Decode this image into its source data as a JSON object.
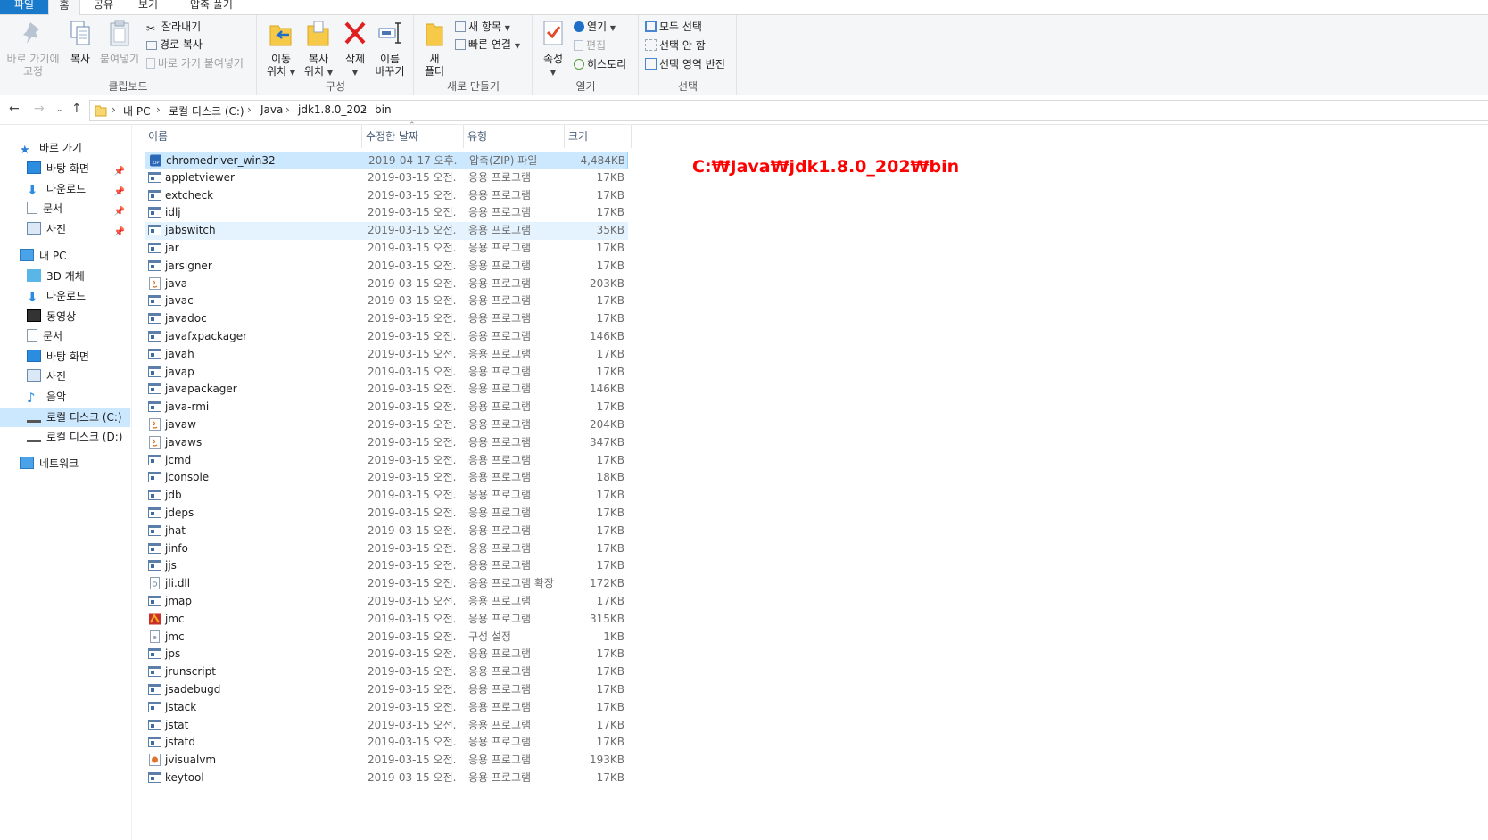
{
  "ribbon_tabs": [
    "파일",
    "홈",
    "공유",
    "보기",
    "압축 풀기"
  ],
  "ribbon": {
    "clipboard": {
      "pin_quick": "바로 가기에\n고정",
      "pin_quick_l1": "바로 가기에",
      "pin_quick_l2": "고정",
      "copy": "복사",
      "paste": "붙여넣기",
      "cut": "잘라내기",
      "copy_path": "경로 복사",
      "paste_shortcut": "바로 가기 붙여넣기",
      "label": "클립보드"
    },
    "organize": {
      "move_l1": "이동",
      "move_l2": "위치",
      "copyto_l1": "복사",
      "copyto_l2": "위치",
      "delete": "삭제",
      "rename_l1": "이름",
      "rename_l2": "바꾸기",
      "label": "구성"
    },
    "new": {
      "new_folder_l1": "새",
      "new_folder_l2": "폴더",
      "new_item": "새 항목",
      "easy_access": "빠른 연결",
      "label": "새로 만들기"
    },
    "open": {
      "properties": "속성",
      "open": "열기",
      "edit": "편집",
      "history": "히스토리",
      "label": "열기"
    },
    "select": {
      "select_all": "모두 선택",
      "select_none": "선택 안 함",
      "invert": "선택 영역 반전",
      "label": "선택"
    }
  },
  "breadcrumb": [
    "내 PC",
    "로컬 디스크 (C:)",
    "Java",
    "jdk1.8.0_202",
    "bin"
  ],
  "nav": {
    "quick_access": "바로 가기",
    "quick_items": [
      "바탕 화면",
      "다운로드",
      "문서",
      "사진"
    ],
    "this_pc": "내 PC",
    "pc_items": [
      "3D 개체",
      "다운로드",
      "동영상",
      "문서",
      "바탕 화면",
      "사진",
      "음악",
      "로컬 디스크 (C:)",
      "로컬 디스크 (D:)"
    ],
    "network": "네트워크"
  },
  "columns": [
    "이름",
    "수정한 날짜",
    "유형",
    "크기"
  ],
  "files": [
    {
      "name": "chromedriver_win32",
      "date": "2019-04-17 오후...",
      "type": "압축(ZIP) 파일",
      "size": "4,484KB",
      "icon": "zip"
    },
    {
      "name": "appletviewer",
      "date": "2019-03-15 오전...",
      "type": "응용 프로그램",
      "size": "17KB",
      "icon": "exe"
    },
    {
      "name": "extcheck",
      "date": "2019-03-15 오전...",
      "type": "응용 프로그램",
      "size": "17KB",
      "icon": "exe"
    },
    {
      "name": "idlj",
      "date": "2019-03-15 오전...",
      "type": "응용 프로그램",
      "size": "17KB",
      "icon": "exe"
    },
    {
      "name": "jabswitch",
      "date": "2019-03-15 오전...",
      "type": "응용 프로그램",
      "size": "35KB",
      "icon": "exe"
    },
    {
      "name": "jar",
      "date": "2019-03-15 오전...",
      "type": "응용 프로그램",
      "size": "17KB",
      "icon": "exe"
    },
    {
      "name": "jarsigner",
      "date": "2019-03-15 오전...",
      "type": "응용 프로그램",
      "size": "17KB",
      "icon": "exe"
    },
    {
      "name": "java",
      "date": "2019-03-15 오전...",
      "type": "응용 프로그램",
      "size": "203KB",
      "icon": "java"
    },
    {
      "name": "javac",
      "date": "2019-03-15 오전...",
      "type": "응용 프로그램",
      "size": "17KB",
      "icon": "exe"
    },
    {
      "name": "javadoc",
      "date": "2019-03-15 오전...",
      "type": "응용 프로그램",
      "size": "17KB",
      "icon": "exe"
    },
    {
      "name": "javafxpackager",
      "date": "2019-03-15 오전...",
      "type": "응용 프로그램",
      "size": "146KB",
      "icon": "exe"
    },
    {
      "name": "javah",
      "date": "2019-03-15 오전...",
      "type": "응용 프로그램",
      "size": "17KB",
      "icon": "exe"
    },
    {
      "name": "javap",
      "date": "2019-03-15 오전...",
      "type": "응용 프로그램",
      "size": "17KB",
      "icon": "exe"
    },
    {
      "name": "javapackager",
      "date": "2019-03-15 오전...",
      "type": "응용 프로그램",
      "size": "146KB",
      "icon": "exe"
    },
    {
      "name": "java-rmi",
      "date": "2019-03-15 오전...",
      "type": "응용 프로그램",
      "size": "17KB",
      "icon": "exe"
    },
    {
      "name": "javaw",
      "date": "2019-03-15 오전...",
      "type": "응용 프로그램",
      "size": "204KB",
      "icon": "java"
    },
    {
      "name": "javaws",
      "date": "2019-03-15 오전...",
      "type": "응용 프로그램",
      "size": "347KB",
      "icon": "java"
    },
    {
      "name": "jcmd",
      "date": "2019-03-15 오전...",
      "type": "응용 프로그램",
      "size": "17KB",
      "icon": "exe"
    },
    {
      "name": "jconsole",
      "date": "2019-03-15 오전...",
      "type": "응용 프로그램",
      "size": "18KB",
      "icon": "exe"
    },
    {
      "name": "jdb",
      "date": "2019-03-15 오전...",
      "type": "응용 프로그램",
      "size": "17KB",
      "icon": "exe"
    },
    {
      "name": "jdeps",
      "date": "2019-03-15 오전...",
      "type": "응용 프로그램",
      "size": "17KB",
      "icon": "exe"
    },
    {
      "name": "jhat",
      "date": "2019-03-15 오전...",
      "type": "응용 프로그램",
      "size": "17KB",
      "icon": "exe"
    },
    {
      "name": "jinfo",
      "date": "2019-03-15 오전...",
      "type": "응용 프로그램",
      "size": "17KB",
      "icon": "exe"
    },
    {
      "name": "jjs",
      "date": "2019-03-15 오전...",
      "type": "응용 프로그램",
      "size": "17KB",
      "icon": "exe"
    },
    {
      "name": "jli.dll",
      "date": "2019-03-15 오전...",
      "type": "응용 프로그램 확장",
      "size": "172KB",
      "icon": "dll"
    },
    {
      "name": "jmap",
      "date": "2019-03-15 오전...",
      "type": "응용 프로그램",
      "size": "17KB",
      "icon": "exe"
    },
    {
      "name": "jmc",
      "date": "2019-03-15 오전...",
      "type": "응용 프로그램",
      "size": "315KB",
      "icon": "jmc"
    },
    {
      "name": "jmc",
      "date": "2019-03-15 오전...",
      "type": "구성 설정",
      "size": "1KB",
      "icon": "ini"
    },
    {
      "name": "jps",
      "date": "2019-03-15 오전...",
      "type": "응용 프로그램",
      "size": "17KB",
      "icon": "exe"
    },
    {
      "name": "jrunscript",
      "date": "2019-03-15 오전...",
      "type": "응용 프로그램",
      "size": "17KB",
      "icon": "exe"
    },
    {
      "name": "jsadebugd",
      "date": "2019-03-15 오전...",
      "type": "응용 프로그램",
      "size": "17KB",
      "icon": "exe"
    },
    {
      "name": "jstack",
      "date": "2019-03-15 오전...",
      "type": "응용 프로그램",
      "size": "17KB",
      "icon": "exe"
    },
    {
      "name": "jstat",
      "date": "2019-03-15 오전...",
      "type": "응용 프로그램",
      "size": "17KB",
      "icon": "exe"
    },
    {
      "name": "jstatd",
      "date": "2019-03-15 오전...",
      "type": "응용 프로그램",
      "size": "17KB",
      "icon": "exe"
    },
    {
      "name": "jvisualvm",
      "date": "2019-03-15 오전...",
      "type": "응용 프로그램",
      "size": "193KB",
      "icon": "jvm"
    },
    {
      "name": "keytool",
      "date": "2019-03-15 오전...",
      "type": "응용 프로그램",
      "size": "17KB",
      "icon": "exe"
    }
  ],
  "path_annotation": "C:₩Java₩jdk1.8.0_202₩bin",
  "colors": {
    "accent": "#1979ca",
    "selection": "#cce8ff",
    "annotation": "#ff0000"
  }
}
